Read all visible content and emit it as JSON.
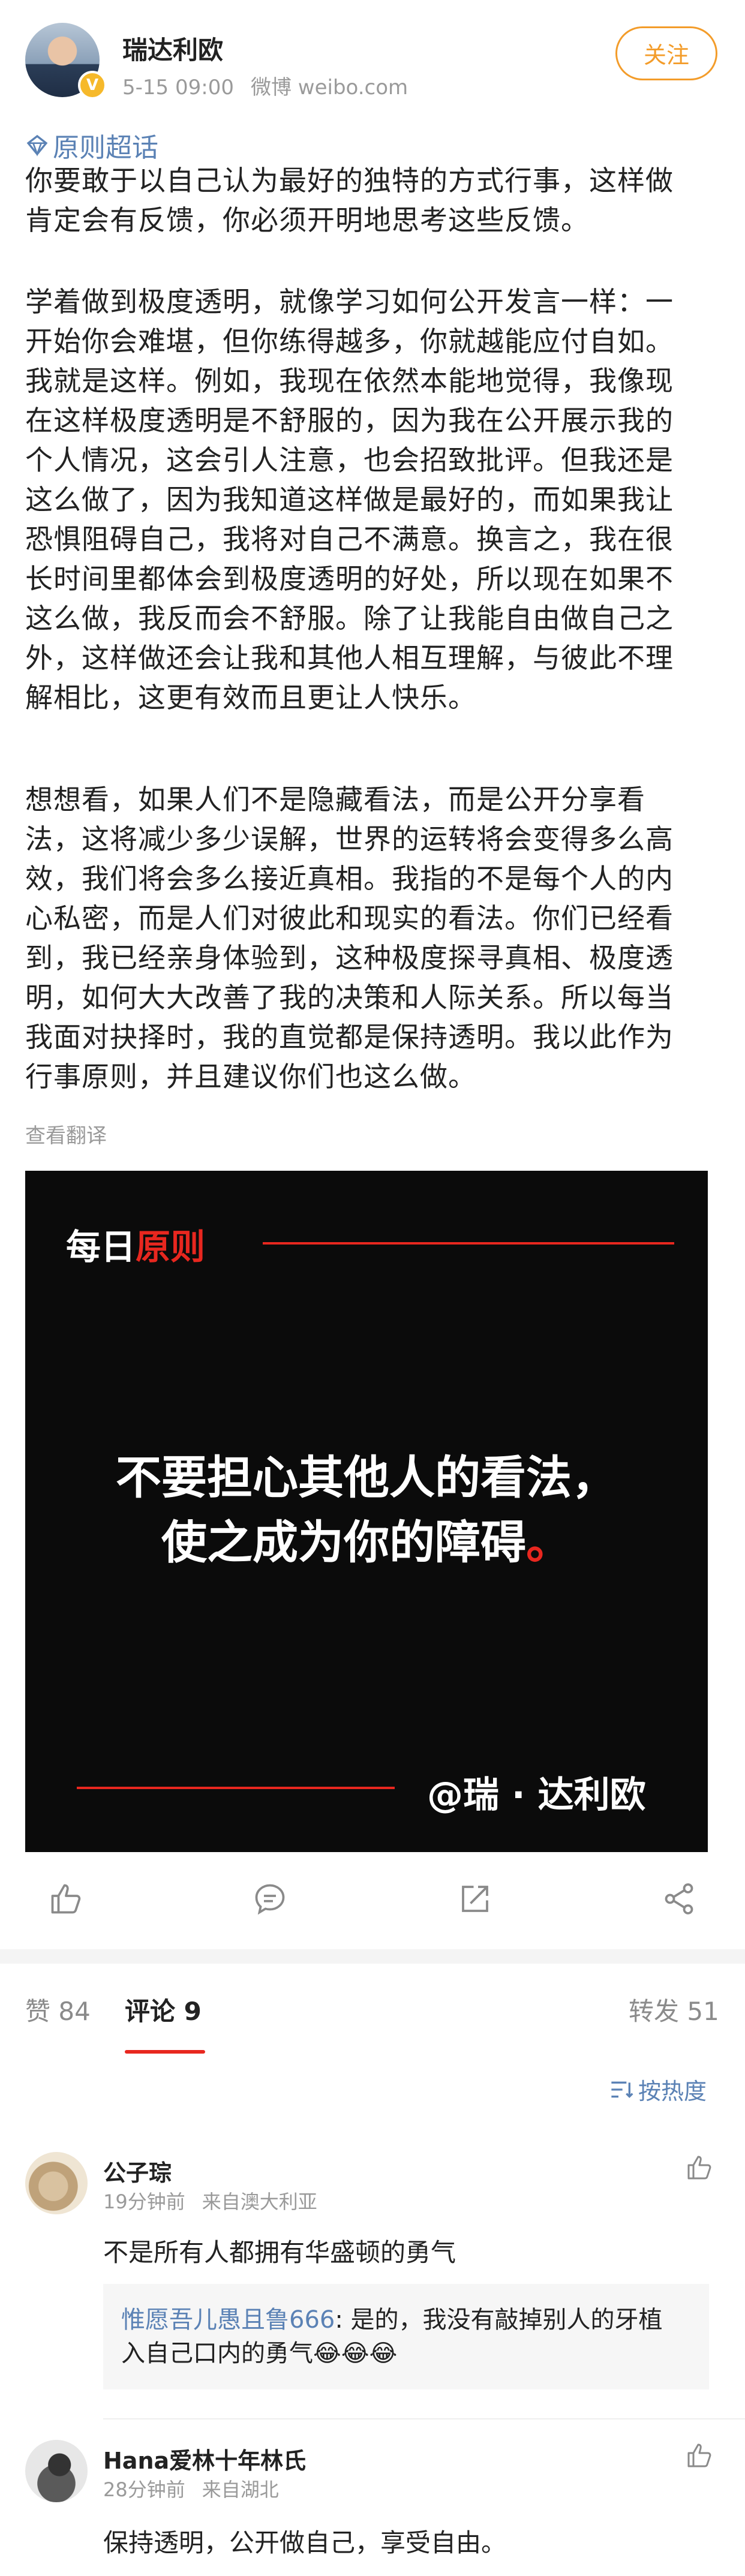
{
  "post": {
    "user_name": "瑞达利欧",
    "time": "5-15 09:00",
    "source": "微博 weibo.com",
    "follow_label": "关注",
    "topic_tag": "原则超话",
    "paragraphs": [
      [
        "你要敢于以自己认为最好的独特的方式行事，这样做",
        "肯定会有反馈，你必须开明地思考这些反馈。"
      ],
      [
        "学着做到极度透明，就像学习如何公开发言一样：一",
        "开始你会难堪，但你练得越多，你就越能应付自如。",
        "我就是这样。例如，我现在依然本能地觉得，我像现",
        "在这样极度透明是不舒服的，因为我在公开展示我的",
        "个人情况，这会引人注意，也会招致批评。但我还是",
        "这么做了，因为我知道这样做是最好的，而如果我让",
        "恐惧阻碍自己，我将对自己不满意。换言之，我在很",
        "长时间里都体会到极度透明的好处，所以现在如果不",
        "这么做，我反而会不舒服。除了让我能自由做自己之",
        "外，这样做还会让我和其他人相互理解，与彼此不理",
        "解相比，这更有效而且更让人快乐。"
      ],
      [
        "想想看，如果人们不是隐藏看法，而是公开分享看",
        "法，这将减少多少误解，世界的运转将会变得多么高",
        "效，我们将会多么接近真相。我指的不是每个人的内",
        "心私密，而是人们对彼此和现实的看法。你们已经看",
        "到，我已经亲身体验到，这种极度探寻真相、极度透",
        "明，如何大大改善了我的决策和人际关系。所以每当",
        "我面对抉择时，我的直觉都是保持透明。我以此作为",
        "行事原则，并且建议你们也这么做。"
      ]
    ],
    "see_translation": "查看翻译"
  },
  "image_card": {
    "header_white": "每日",
    "header_red": "原则",
    "quote_line1": "不要担心其他人的看法，",
    "quote_line2": "使之成为你的障碍",
    "quote_dot": "。",
    "signature": "@瑞 · 达利欧",
    "accent_color": "#e8271f"
  },
  "actions": {
    "icons": [
      "like-icon",
      "comment-icon",
      "share-icon",
      "more-icon"
    ]
  },
  "tabs": {
    "likes": "赞 84",
    "comments": "评论 9",
    "reposts": "转发 51",
    "sort": "按热度"
  },
  "comments": [
    {
      "name": "公子琮",
      "time": "19分钟前",
      "location": "来自澳大利亚",
      "text": "不是所有人都拥有华盛顿的勇气",
      "reply": {
        "user": "惟愿吾儿愚且鲁666",
        "line1": ": 是的，我没有敲掉别人的牙植",
        "line2": "入自己口内的勇气😂😂😂"
      }
    },
    {
      "name": "Hana爱林十年林氏",
      "time": "28分钟前",
      "location": "来自湖北",
      "text": "保持透明，公开做自己，享受自由。"
    }
  ],
  "colors": {
    "link": "#5b82b5",
    "follow": "#f39c2a",
    "meta_gray": "#9a9a9a"
  }
}
